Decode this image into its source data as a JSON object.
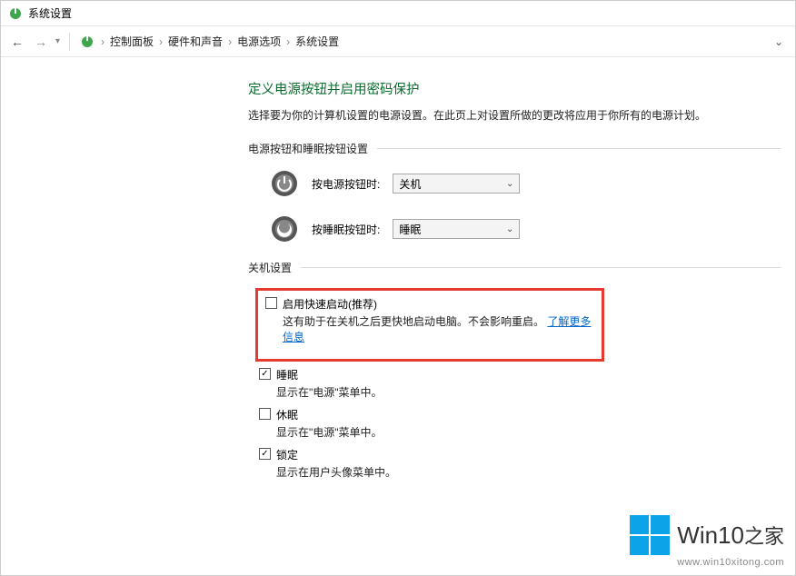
{
  "window": {
    "title": "系统设置"
  },
  "breadcrumb": {
    "items": [
      "控制面板",
      "硬件和声音",
      "电源选项",
      "系统设置"
    ]
  },
  "page": {
    "title": "定义电源按钮并启用密码保护",
    "subtitle": "选择要为你的计算机设置的电源设置。在此页上对设置所做的更改将应用于你所有的电源计划。"
  },
  "buttons_section": {
    "header": "电源按钮和睡眠按钮设置",
    "power_button_label": "按电源按钮时:",
    "power_button_value": "关机",
    "sleep_button_label": "按睡眠按钮时:",
    "sleep_button_value": "睡眠"
  },
  "shutdown_section": {
    "header": "关机设置",
    "fast_startup": {
      "label": "启用快速启动(推荐)",
      "desc_prefix": "这有助于在关机之后更快地启动电脑。不会影响重启。",
      "link": "了解更多信息",
      "checked": false
    },
    "sleep": {
      "label": "睡眠",
      "desc": "显示在\"电源\"菜单中。",
      "checked": true
    },
    "hibernate": {
      "label": "休眠",
      "desc": "显示在\"电源\"菜单中。",
      "checked": false
    },
    "lock": {
      "label": "锁定",
      "desc": "显示在用户头像菜单中。",
      "checked": true
    }
  },
  "watermark": {
    "brand": "Win10",
    "suffix": "之家",
    "url": "www.win10xitong.com"
  }
}
